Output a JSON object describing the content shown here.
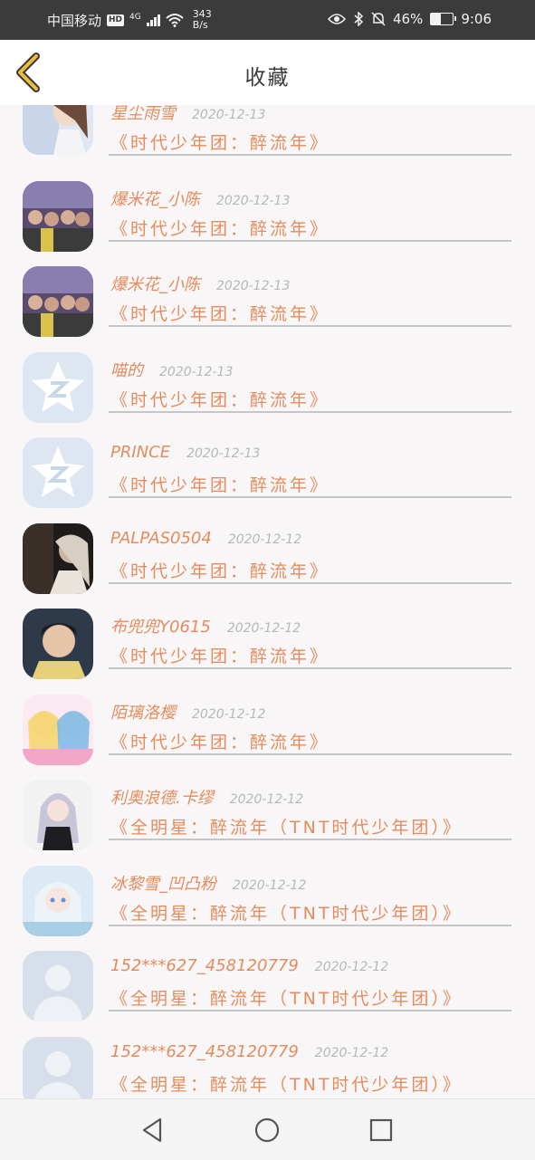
{
  "status_bar": {
    "carrier": "中国移动",
    "hd": "HD",
    "network": "4G",
    "speed_value": "343",
    "speed_unit": "B/s",
    "battery": "46%",
    "time": "9:06"
  },
  "header": {
    "title": "收藏"
  },
  "items": [
    {
      "username": "星尘雨雪",
      "date": "2020-12-13",
      "title": "《时代少年团：醉流年》",
      "avatar_icon": "anime-couple-avatar"
    },
    {
      "username": "爆米花_小陈",
      "date": "2020-12-13",
      "title": "《时代少年团：醉流年》",
      "avatar_icon": "group-photo-avatar"
    },
    {
      "username": "爆米花_小陈",
      "date": "2020-12-13",
      "title": "《时代少年团：醉流年》",
      "avatar_icon": "group-photo-avatar"
    },
    {
      "username": "喵的",
      "date": "2020-12-13",
      "title": "《时代少年团：醉流年》",
      "avatar_icon": "qzone-star-avatar"
    },
    {
      "username": "PRINCE",
      "date": "2020-12-13",
      "title": "《时代少年团：醉流年》",
      "avatar_icon": "qzone-star-avatar"
    },
    {
      "username": "PALPAS0504",
      "date": "2020-12-12",
      "title": "《时代少年团：醉流年》",
      "avatar_icon": "dark-photo-avatar"
    },
    {
      "username": "布兜兜Y0615",
      "date": "2020-12-12",
      "title": "《时代少年团：醉流年》",
      "avatar_icon": "boy-photo-avatar"
    },
    {
      "username": "陌璃洛樱",
      "date": "2020-12-12",
      "title": "《时代少年团：醉流年》",
      "avatar_icon": "anime-girls-avatar"
    },
    {
      "username": "利奥浪德.卡缪",
      "date": "2020-12-12",
      "title": "《全明星：醉流年（TNT时代少年团）》",
      "avatar_icon": "anime-dark-avatar"
    },
    {
      "username": "冰黎雪_凹凸粉",
      "date": "2020-12-12",
      "title": "《全明星：醉流年（TNT时代少年团）》",
      "avatar_icon": "anime-blue-avatar"
    },
    {
      "username": "152***627_458120779",
      "date": "2020-12-12",
      "title": "《全明星：醉流年（TNT时代少年团）》",
      "avatar_icon": "default-person-avatar"
    },
    {
      "username": "152***627_458120779",
      "date": "2020-12-12",
      "title": "《全明星：醉流年（TNT时代少年团）》",
      "avatar_icon": "default-person-avatar"
    }
  ],
  "colors": {
    "accent_orange": "#e48c5e",
    "date_gray": "#b8b8b8",
    "status_bar_bg": "#3b3b3b",
    "back_arrow": "#e9be3f"
  }
}
